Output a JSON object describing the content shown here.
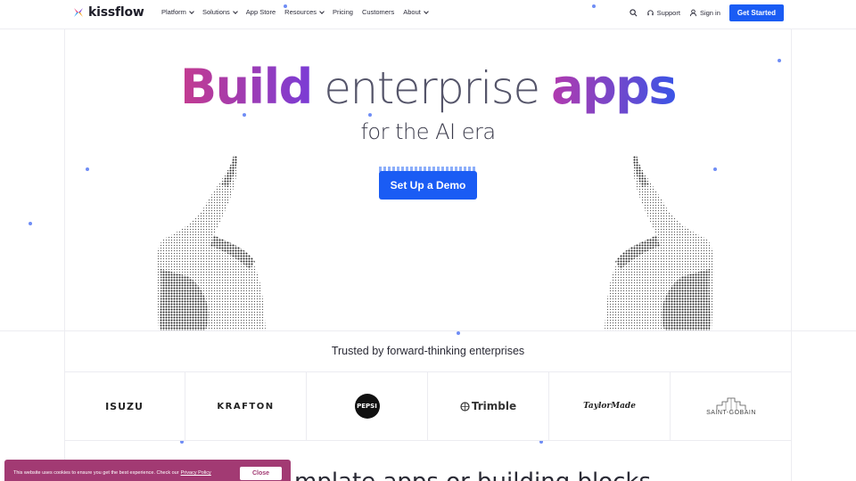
{
  "header": {
    "brand": "kissflow",
    "nav": [
      {
        "label": "Platform",
        "has_dropdown": true
      },
      {
        "label": "Solutions",
        "has_dropdown": true
      },
      {
        "label": "App Store",
        "has_dropdown": false
      },
      {
        "label": "Resources",
        "has_dropdown": true
      },
      {
        "label": "Pricing",
        "has_dropdown": false
      },
      {
        "label": "Customers",
        "has_dropdown": false
      },
      {
        "label": "About",
        "has_dropdown": true
      }
    ],
    "support_label": "Support",
    "signin_label": "Sign in",
    "cta_label": "Get Started"
  },
  "hero": {
    "title_word1": "Build",
    "title_word2": "enterprise",
    "title_word3": "apps",
    "subtitle": "for the AI era",
    "demo_label": "Set Up a Demo"
  },
  "trusted": {
    "heading": "Trusted by forward-thinking enterprises",
    "logos": [
      "ISUZU",
      "KRAFTON",
      "PEPSI",
      "Trimble",
      "TaylorMade",
      "SAINT-GOBAIN"
    ]
  },
  "next_section": {
    "heading_partial": "mplate apps or building blocks"
  },
  "cookie": {
    "text": "This website uses cookies to ensure you get the best experience. Check our",
    "link": "Privacy Policy",
    "close_label": "Close"
  },
  "colors": {
    "primary": "#1a5cf4",
    "cookie_bg": "#a23a73"
  }
}
